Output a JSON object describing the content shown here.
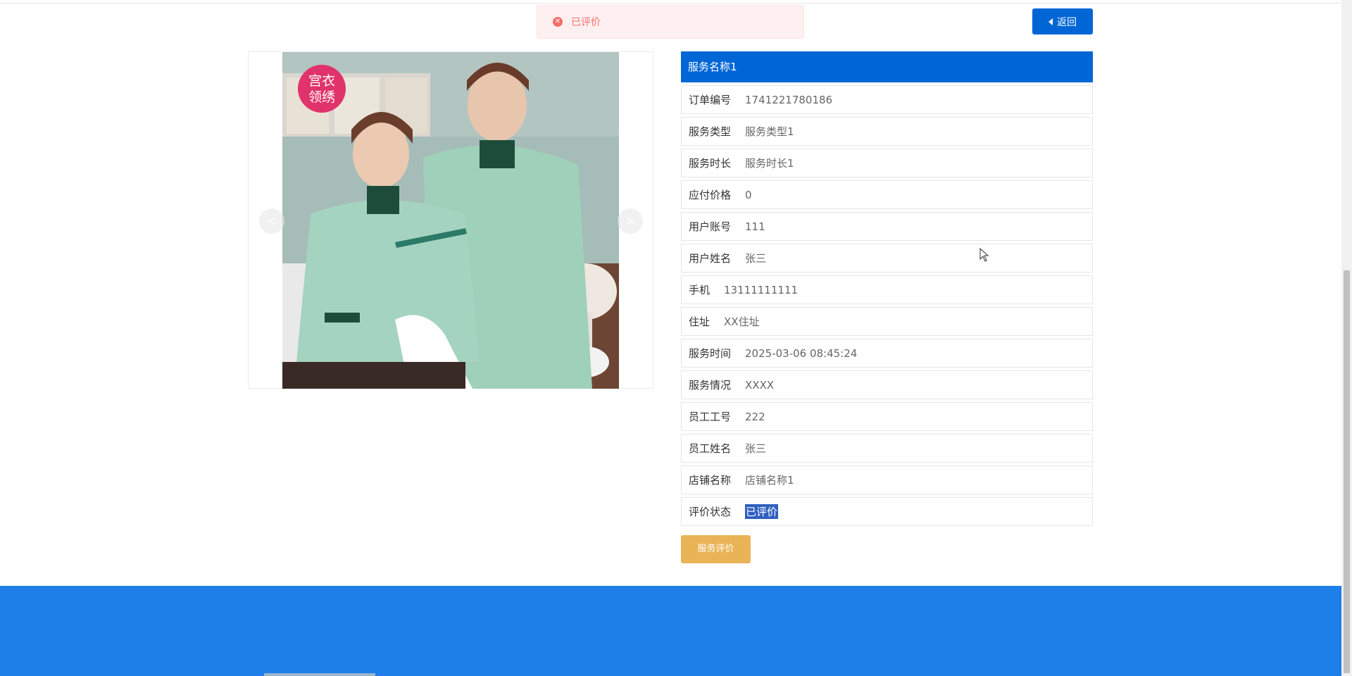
{
  "toast": {
    "text": "已评价",
    "icon": "error-circle-icon"
  },
  "back_button": {
    "label": "返回",
    "icon": "caret-left-icon"
  },
  "carousel": {
    "badge_line1": "宫衣",
    "badge_line2": "领绣",
    "prev_label": "<",
    "next_label": ">"
  },
  "info": {
    "title": "服务名称1",
    "rows": [
      {
        "label": "订单编号",
        "value": "1741221780186"
      },
      {
        "label": "服务类型",
        "value": "服务类型1"
      },
      {
        "label": "服务时长",
        "value": "服务时长1"
      },
      {
        "label": "应付价格",
        "value": "0"
      },
      {
        "label": "用户账号",
        "value": "111"
      },
      {
        "label": "用户姓名",
        "value": "张三"
      },
      {
        "label": "手机",
        "value": "13111111111"
      },
      {
        "label": "住址",
        "value": "XX住址"
      },
      {
        "label": "服务时间",
        "value": "2025-03-06 08:45:24"
      },
      {
        "label": "服务情况",
        "value": "XXXX"
      },
      {
        "label": "员工工号",
        "value": "222"
      },
      {
        "label": "员工姓名",
        "value": "张三"
      },
      {
        "label": "店铺名称",
        "value": "店铺名称1"
      },
      {
        "label": "评价状态",
        "value": "已评价"
      }
    ]
  },
  "rate_button": {
    "label": "服务评价"
  },
  "colors": {
    "primary": "#0066d6",
    "footer": "#1e7fe8",
    "rate_button": "#e9b455",
    "toast_bg": "#fef0f0",
    "toast_text": "#f56c6c"
  }
}
